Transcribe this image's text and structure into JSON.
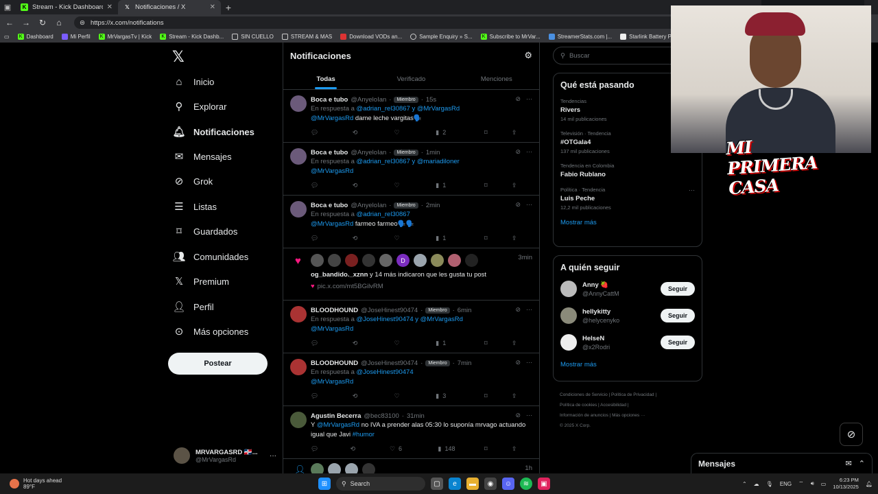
{
  "browser": {
    "tabs": [
      {
        "title": "Stream - Kick Dashboard",
        "favicon": "kick-icon",
        "color": "#53fc18"
      },
      {
        "title": "Notificaciones / X",
        "favicon": "x-icon",
        "color": "#ffffff"
      }
    ],
    "url": "https://x.com/notifications",
    "bookmarks": [
      {
        "label": "Dashboard"
      },
      {
        "label": "Mi Perfil"
      },
      {
        "label": "MrVargasTv | Kick"
      },
      {
        "label": "Stream - Kick Dashb..."
      },
      {
        "label": "SIN CUELLO"
      },
      {
        "label": "STREAM & MAS"
      },
      {
        "label": "Download VODs an..."
      },
      {
        "label": "Sample Enquiry » S..."
      },
      {
        "label": "Subscribe to MrVar..."
      },
      {
        "label": "StreamerStats.com |..."
      },
      {
        "label": "Starlink Battery Pow..."
      }
    ]
  },
  "sidebar": {
    "items": [
      {
        "label": "Inicio",
        "icon": "home-icon"
      },
      {
        "label": "Explorar",
        "icon": "search-icon"
      },
      {
        "label": "Notificaciones",
        "icon": "bell-icon"
      },
      {
        "label": "Mensajes",
        "icon": "mail-icon"
      },
      {
        "label": "Grok",
        "icon": "grok-icon"
      },
      {
        "label": "Listas",
        "icon": "list-icon"
      },
      {
        "label": "Guardados",
        "icon": "bookmark-icon"
      },
      {
        "label": "Comunidades",
        "icon": "communities-icon"
      },
      {
        "label": "Premium",
        "icon": "x-icon"
      },
      {
        "label": "Perfil",
        "icon": "person-icon"
      },
      {
        "label": "Más opciones",
        "icon": "more-icon"
      }
    ],
    "post_label": "Postear",
    "account": {
      "name": "MRVARGASRD 🇩🇴...",
      "handle": "@MrVargasRd"
    }
  },
  "main": {
    "title": "Notificaciones",
    "tabs": [
      "Todas",
      "Verificado",
      "Menciones"
    ],
    "notifications": [
      {
        "name": "Boca e tubo",
        "handle": "@AnyeloIan",
        "badge": "Miembro",
        "time": "15s",
        "reply_prefix": "En respuesta a",
        "reply_to": "@adrian_rel30867 y @MrVargasRd",
        "mention": "@MrVargasRd",
        "text": "dame leche vargitas🗣️",
        "views": "2"
      },
      {
        "name": "Boca e tubo",
        "handle": "@AnyeloIan",
        "badge": "Miembro",
        "time": "1min",
        "reply_prefix": "En respuesta a",
        "reply_to": "@adrian_rel30867 y @mariadiloner",
        "mention": "@MrVargasRd",
        "text": "",
        "views": "1"
      },
      {
        "name": "Boca e tubo",
        "handle": "@AnyeloIan",
        "badge": "Miembro",
        "time": "2min",
        "reply_prefix": "En respuesta a",
        "reply_to": "@adrian_rel30867",
        "mention": "@MrVargasRd",
        "text": "farmeo farmeo🗣️🗣️",
        "views": "1"
      }
    ],
    "likes": {
      "user": "og_bandido._xznn",
      "text": "y 14 más indicaron que les gusta tu post",
      "pic": "pic.x.com/mt5BGilvRM",
      "time": "3min",
      "avatar_letter": "D"
    },
    "notifications2": [
      {
        "name": "BLOODHOUND",
        "handle": "@JoseHinest90474",
        "badge": "Miembro",
        "time": "6min",
        "reply_prefix": "En respuesta a",
        "reply_to": "@JoseHinest90474 y @MrVargasRd",
        "mention": "@MrVargasRd",
        "text": "",
        "views": "1",
        "likes": ""
      },
      {
        "name": "BLOODHOUND",
        "handle": "@JoseHinest90474",
        "badge": "Miembro",
        "time": "7min",
        "reply_prefix": "En respuesta a",
        "reply_to": "@JoseHinest90474",
        "mention": "@MrVargasRd",
        "text": "",
        "views": "3",
        "likes": ""
      },
      {
        "name": "Agustin Becerra",
        "handle": "@bec83100",
        "badge": "",
        "time": "31min",
        "reply_prefix": "",
        "reply_to": "",
        "mention": "@MrVargasRd",
        "text_pre": "Y",
        "text": "no IVA a prender alas 05:30 lo suponía mrvago actuando igual que Javi",
        "hashtag": "#humor",
        "views": "148",
        "likes": "6"
      }
    ],
    "last_time": "1h"
  },
  "right": {
    "search_placeholder": "Buscar",
    "trends_title": "Qué está pasando",
    "trends": [
      {
        "context": "Tendencias",
        "name": "Rivers",
        "count": "14 mil publicaciones"
      },
      {
        "context": "Televisión · Tendencia",
        "name": "#OTGala4",
        "count": "137 mil publicaciones"
      },
      {
        "context": "Tendencia en Colombia",
        "name": "Fabio Rublano",
        "count": ""
      },
      {
        "context": "Política · Tendencia",
        "name": "Luis Peche",
        "count": "12,2 mil publicaciones"
      }
    ],
    "show_more": "Mostrar más",
    "who_title": "A quién seguir",
    "who": [
      {
        "name": "Anny 🍓",
        "handle": "@AnnyCattM",
        "btn": "Seguir"
      },
      {
        "name": "hellykitty",
        "handle": "@helycenyko",
        "btn": "Seguir"
      },
      {
        "name": "HelseN",
        "handle": "@x2Rodri",
        "btn": "Seguir"
      }
    ],
    "footer": {
      "l1a": "Condiciones de Servicio",
      "l1b": "Política de Privacidad",
      "l2a": "Política de cookies",
      "l2b": "Accesibilidad",
      "l3a": "Información de anuncios",
      "l3b": "Más opciones ···",
      "l4": "© 2025 X Corp."
    }
  },
  "overlay": {
    "banner": "MI PRIMERA CASA"
  },
  "messages_bar": {
    "title": "Mensajes"
  },
  "taskbar": {
    "weather_title": "Hot days ahead",
    "weather_temp": "89°F",
    "search_label": "Search",
    "lang": "ENG",
    "time": "6:23 PM",
    "date": "10/13/2025"
  }
}
